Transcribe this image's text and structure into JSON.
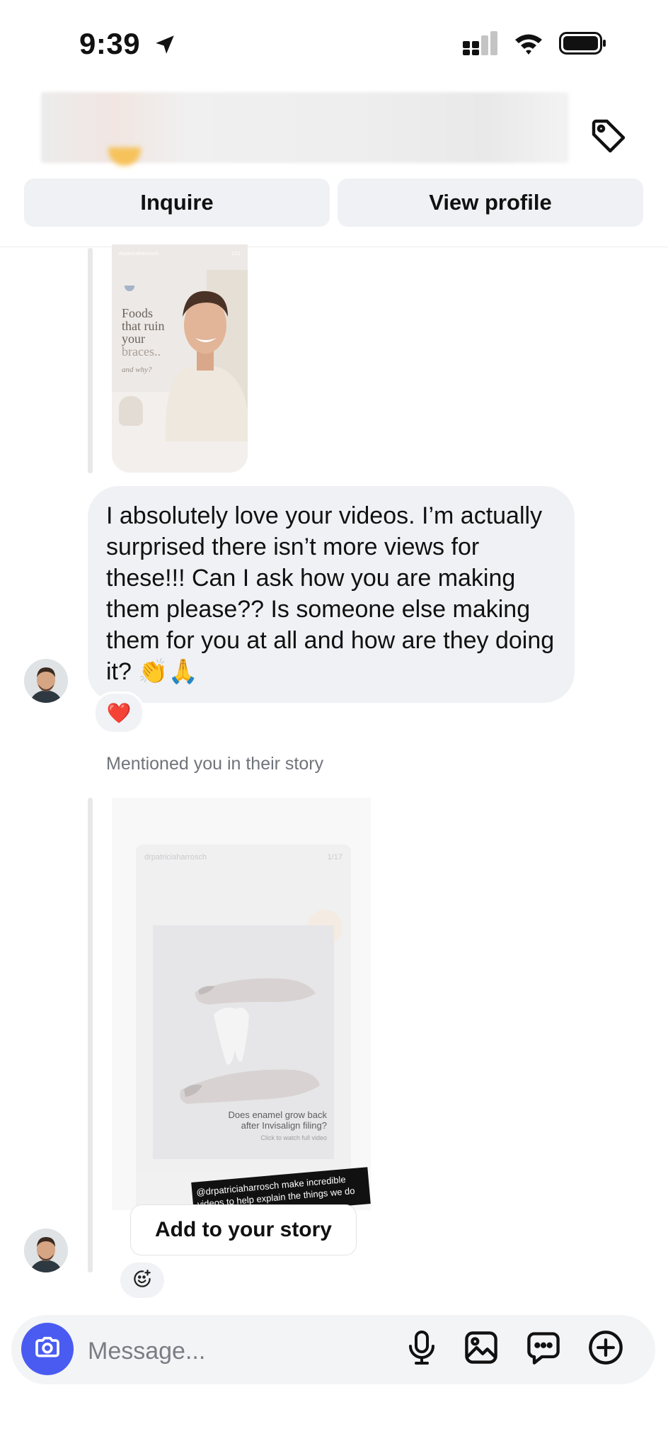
{
  "status_bar": {
    "time": "9:39"
  },
  "header": {
    "inquire_label": "Inquire",
    "view_profile_label": "View profile"
  },
  "story1": {
    "overlay_lines": [
      "Foods",
      "that ruin",
      "your",
      "braces..",
      "and why?"
    ],
    "handle": "drpatriciaharrosch",
    "counter": "1/11"
  },
  "message": {
    "text": "I absolutely love your videos. I’m actually surprised there isn’t more views for these!!! Can I ask how you are making them please?? Is someone else making them for you at all and how are they doing it? 👏🙏",
    "reaction": "❤️"
  },
  "mention": {
    "label": "Mentioned you in their story",
    "handle": "drpatriciaharrosch",
    "counter": "1/17",
    "caption_line1": "Does enamel grow back",
    "caption_line2": "after Invisalign filing?",
    "caption_small": "Click to watch full video",
    "sticker_text": "@drpatriciaharrosch make incredible videos to help explain the things we do",
    "add_story_label": "Add to your story"
  },
  "composer": {
    "placeholder": "Message..."
  },
  "colors": {
    "accent": "#4a5bf1",
    "bubble": "#eff1f4",
    "reaction": "#e0253a"
  }
}
